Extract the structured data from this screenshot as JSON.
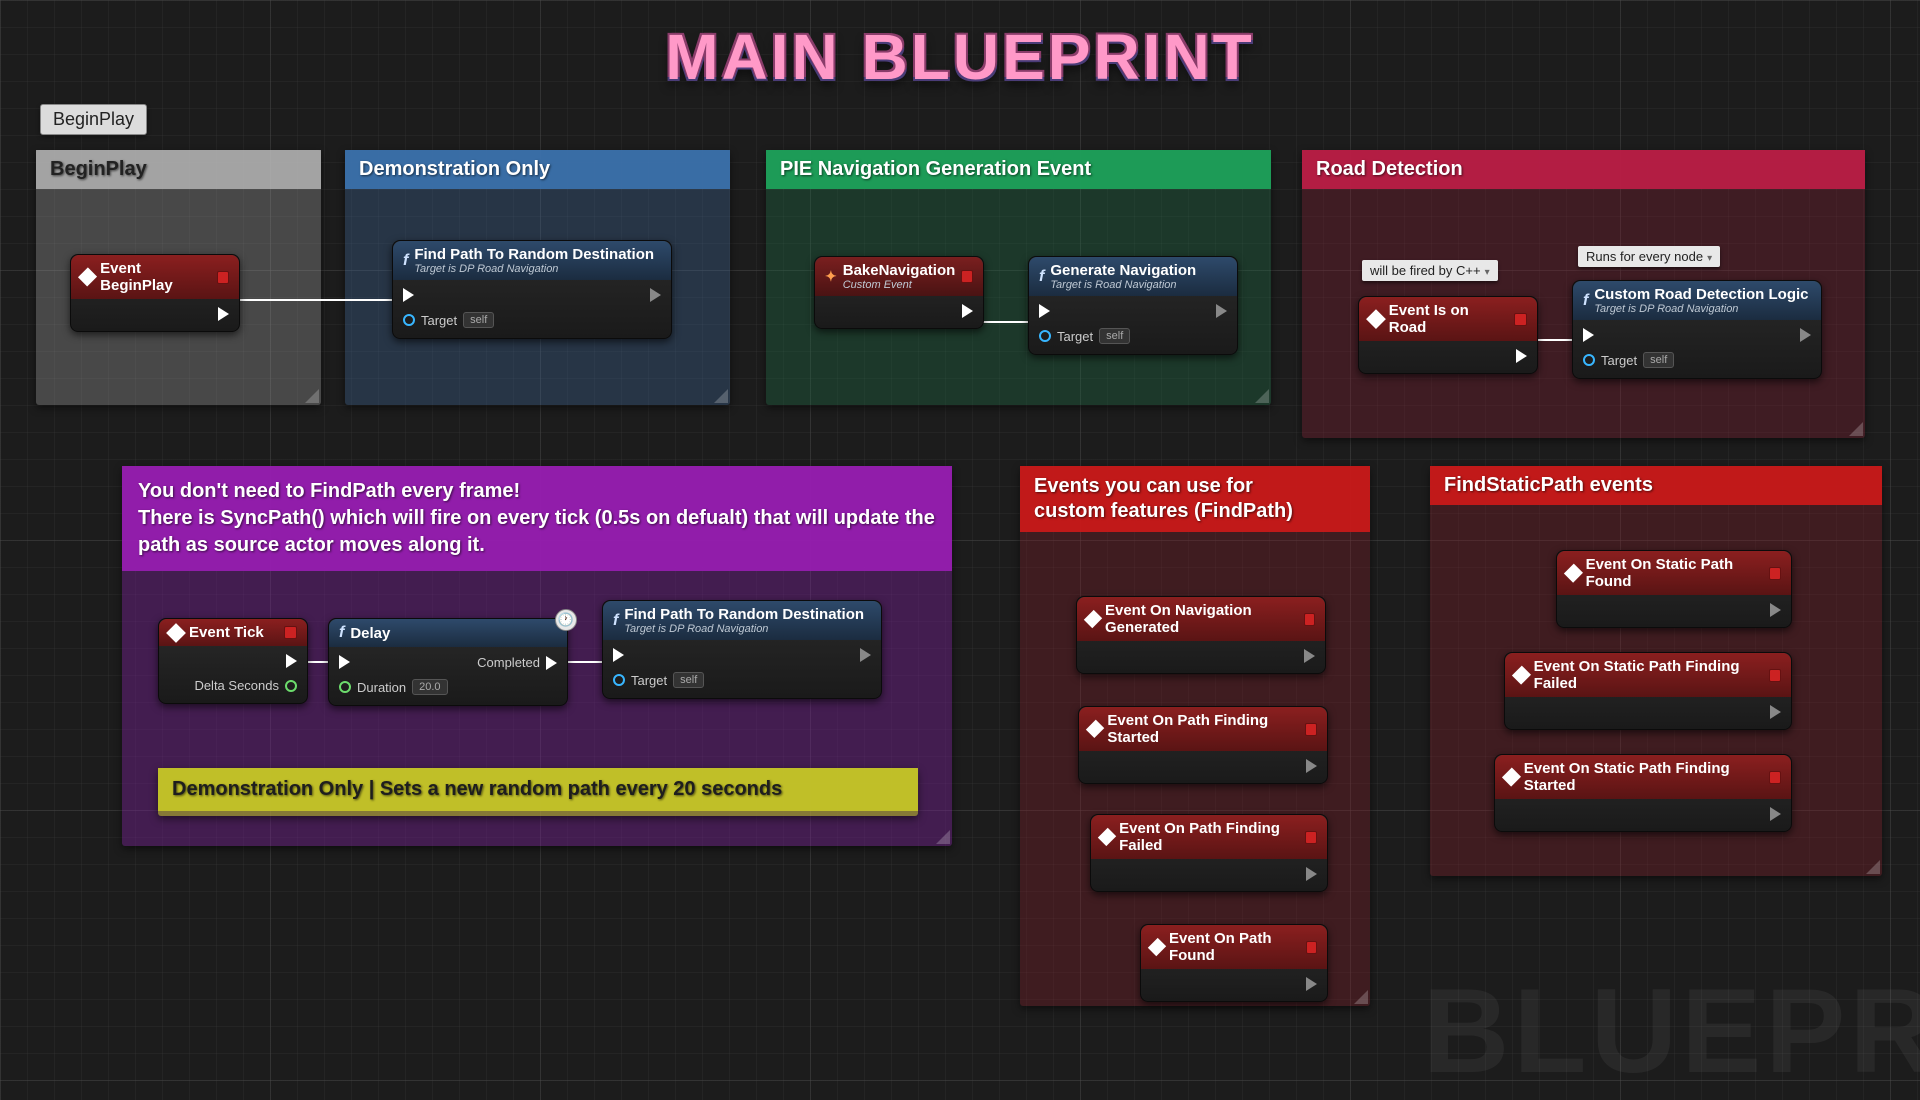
{
  "page_title": "MAIN BLUEPRINT",
  "watermark": "BLUEPR",
  "top_tooltip": "BeginPlay",
  "comments": {
    "beginplay": {
      "title": "BeginPlay"
    },
    "demo": {
      "title": "Demonstration Only"
    },
    "pie": {
      "title": "PIE Navigation Generation Event"
    },
    "road": {
      "title": "Road Detection"
    },
    "purple_text": "You don't need to FindPath every frame!\nThere is SyncPath() which will fire on every tick (0.5s on defualt) that will update the path as source actor moves along it.",
    "events_findpath": {
      "title": "Events you can use for custom features (FindPath)"
    },
    "findstatic": {
      "title": "FindStaticPath events"
    },
    "yellow_note": "Demonstration Only | Sets a new random path every 20 seconds"
  },
  "notes": {
    "road_cpp": "will be fired by C++",
    "road_runs": "Runs for every node"
  },
  "nodes": {
    "event_beginplay": "Event BeginPlay",
    "findpath1": {
      "title": "Find Path To Random Destination",
      "sub": "Target is DP Road Navigation",
      "target": "Target",
      "self": "self"
    },
    "bakenav": {
      "title": "BakeNavigation",
      "sub": "Custom Event"
    },
    "gennav": {
      "title": "Generate Navigation",
      "sub": "Target is Road Navigation",
      "target": "Target",
      "self": "self"
    },
    "eventisonroad": "Event Is on Road",
    "customroad": {
      "title": "Custom Road Detection Logic",
      "sub": "Target is DP Road Navigation",
      "target": "Target",
      "self": "self"
    },
    "eventtick": {
      "title": "Event Tick",
      "delta": "Delta Seconds"
    },
    "delay": {
      "title": "Delay",
      "duration_label": "Duration",
      "duration_value": "20.0",
      "completed": "Completed"
    },
    "findpath2": {
      "title": "Find Path To Random Destination",
      "sub": "Target is DP Road Navigation",
      "target": "Target",
      "self": "self"
    },
    "ev_navgen": "Event On Navigation Generated",
    "ev_pathstart": "Event On Path Finding Started",
    "ev_pathfail": "Event On Path Finding Failed",
    "ev_pathfound": "Event On Path Found",
    "ev_static_found": "Event On Static Path Found",
    "ev_static_fail": "Event On Static Path Finding Failed",
    "ev_static_start": "Event On Static Path Finding Started"
  }
}
